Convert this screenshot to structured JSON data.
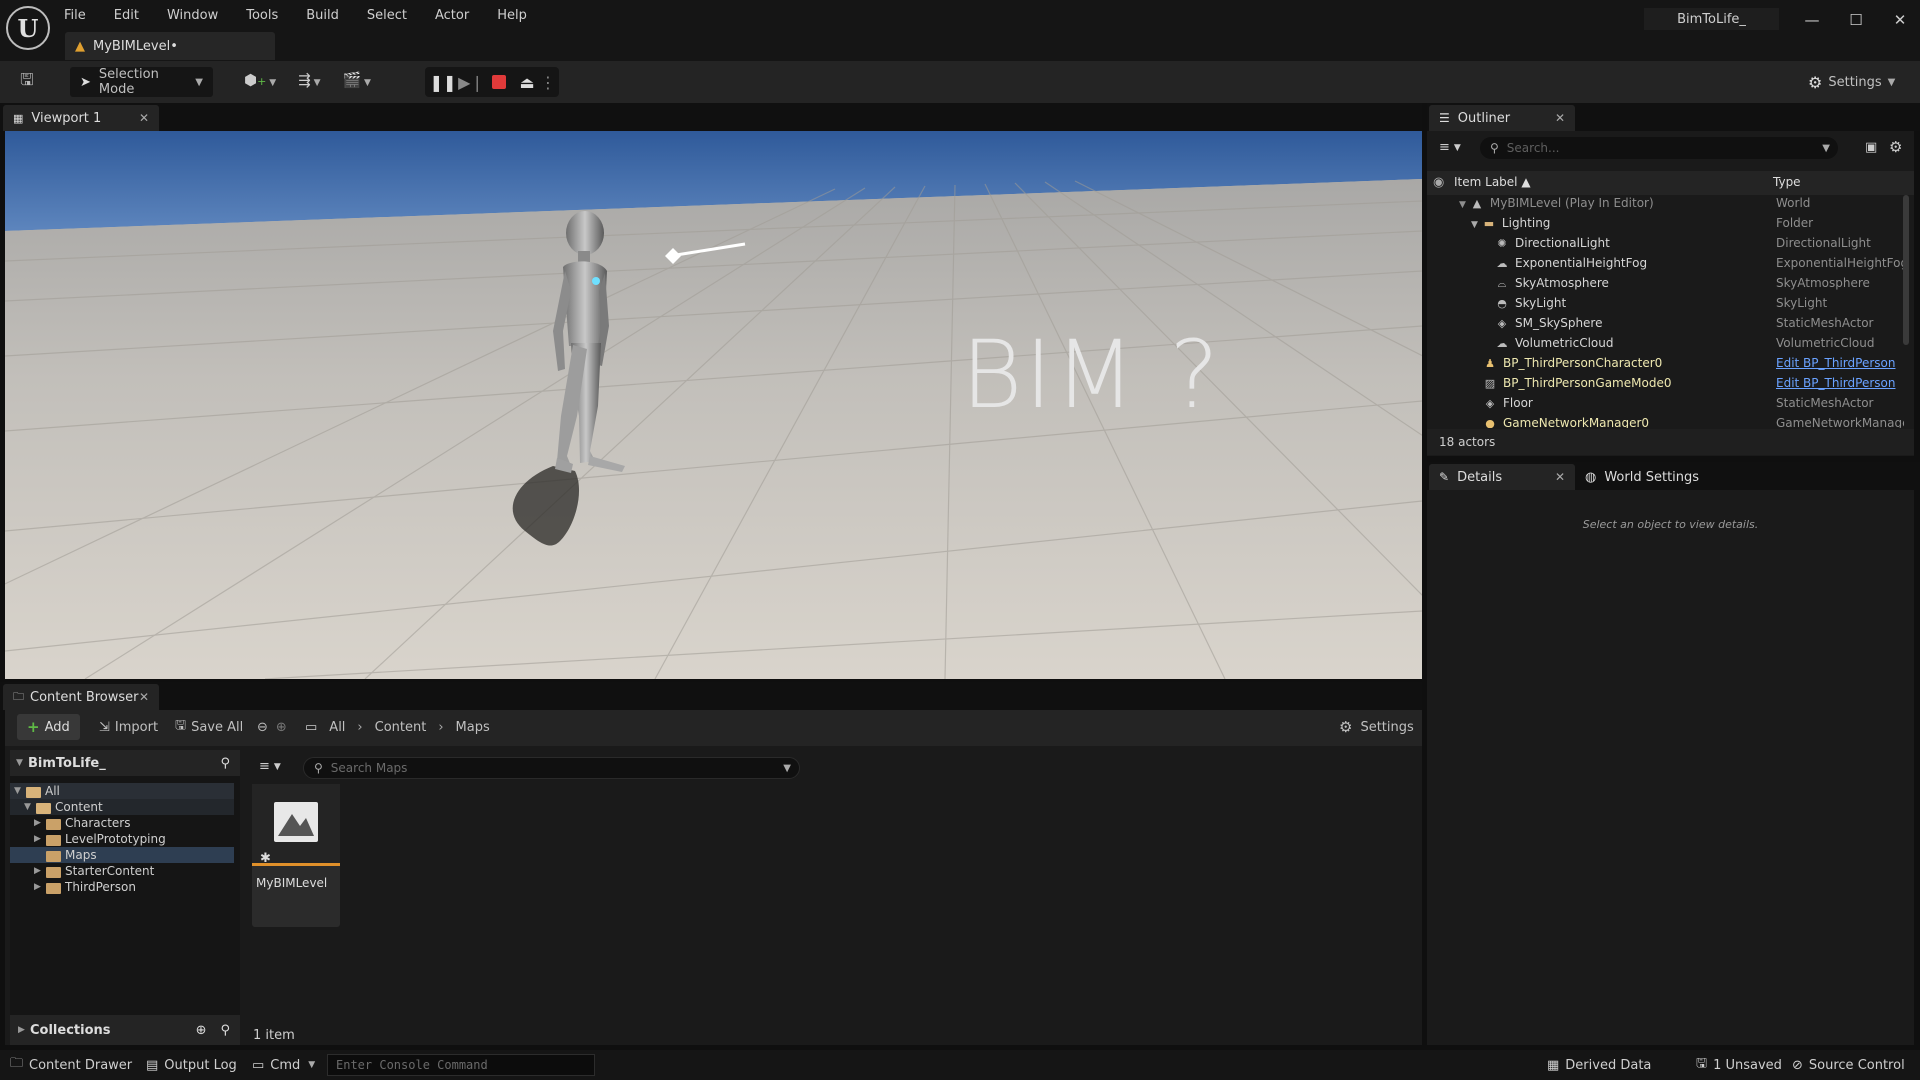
{
  "app": {
    "level_tab": "MyBIMLevel•",
    "project_title": "BimToLife_"
  },
  "menu": [
    "File",
    "Edit",
    "Window",
    "Tools",
    "Build",
    "Select",
    "Actor",
    "Help"
  ],
  "toolbar": {
    "selection_mode": "Selection Mode",
    "settings": "Settings"
  },
  "viewport": {
    "tab": "Viewport 1",
    "overlay_text": "BIM ?"
  },
  "content_browser": {
    "tab": "Content Browser",
    "add": "Add",
    "import": "Import",
    "save_all": "Save All",
    "breadcrumb": [
      "All",
      "Content",
      "Maps"
    ],
    "settings": "Settings",
    "tree_root": "BimToLife_",
    "tree": [
      "All",
      "Content",
      "Characters",
      "LevelPrototyping",
      "Maps",
      "StarterContent",
      "ThirdPerson"
    ],
    "search_placeholder": "Search Maps",
    "asset_name": "MyBIMLevel",
    "collections": "Collections",
    "item_count": "1 item"
  },
  "outliner": {
    "tab": "Outliner",
    "search_placeholder": "Search...",
    "col_label": "Item Label ▲",
    "col_type": "Type",
    "rows": [
      {
        "label": "MyBIMLevel (Play In Editor)",
        "type": "World"
      },
      {
        "label": "Lighting",
        "type": "Folder"
      },
      {
        "label": "DirectionalLight",
        "type": "DirectionalLight"
      },
      {
        "label": "ExponentialHeightFog",
        "type": "ExponentialHeightFog"
      },
      {
        "label": "SkyAtmosphere",
        "type": "SkyAtmosphere"
      },
      {
        "label": "SkyLight",
        "type": "SkyLight"
      },
      {
        "label": "SM_SkySphere",
        "type": "StaticMeshActor"
      },
      {
        "label": "VolumetricCloud",
        "type": "VolumetricCloud"
      },
      {
        "label": "BP_ThirdPersonCharacter0",
        "type": "Edit BP_ThirdPerson"
      },
      {
        "label": "BP_ThirdPersonGameMode0",
        "type": "Edit BP_ThirdPerson"
      },
      {
        "label": "Floor",
        "type": "StaticMeshActor"
      },
      {
        "label": "GameNetworkManager0",
        "type": "GameNetworkManager"
      }
    ],
    "actor_count": "18 actors"
  },
  "details": {
    "tab": "Details",
    "world_tab": "World Settings",
    "hint": "Select an object to view details."
  },
  "statusbar": {
    "content_drawer": "Content Drawer",
    "output_log": "Output Log",
    "cmd": "Cmd",
    "console_placeholder": "Enter Console Command",
    "derived_data": "Derived Data",
    "unsaved": "1 Unsaved",
    "source_control": "Source Control"
  },
  "colors": {
    "accent_orange": "#e0902a",
    "link_blue": "#6aa2ff",
    "stop_red": "#e03a3a",
    "add_green": "#5fba46"
  }
}
